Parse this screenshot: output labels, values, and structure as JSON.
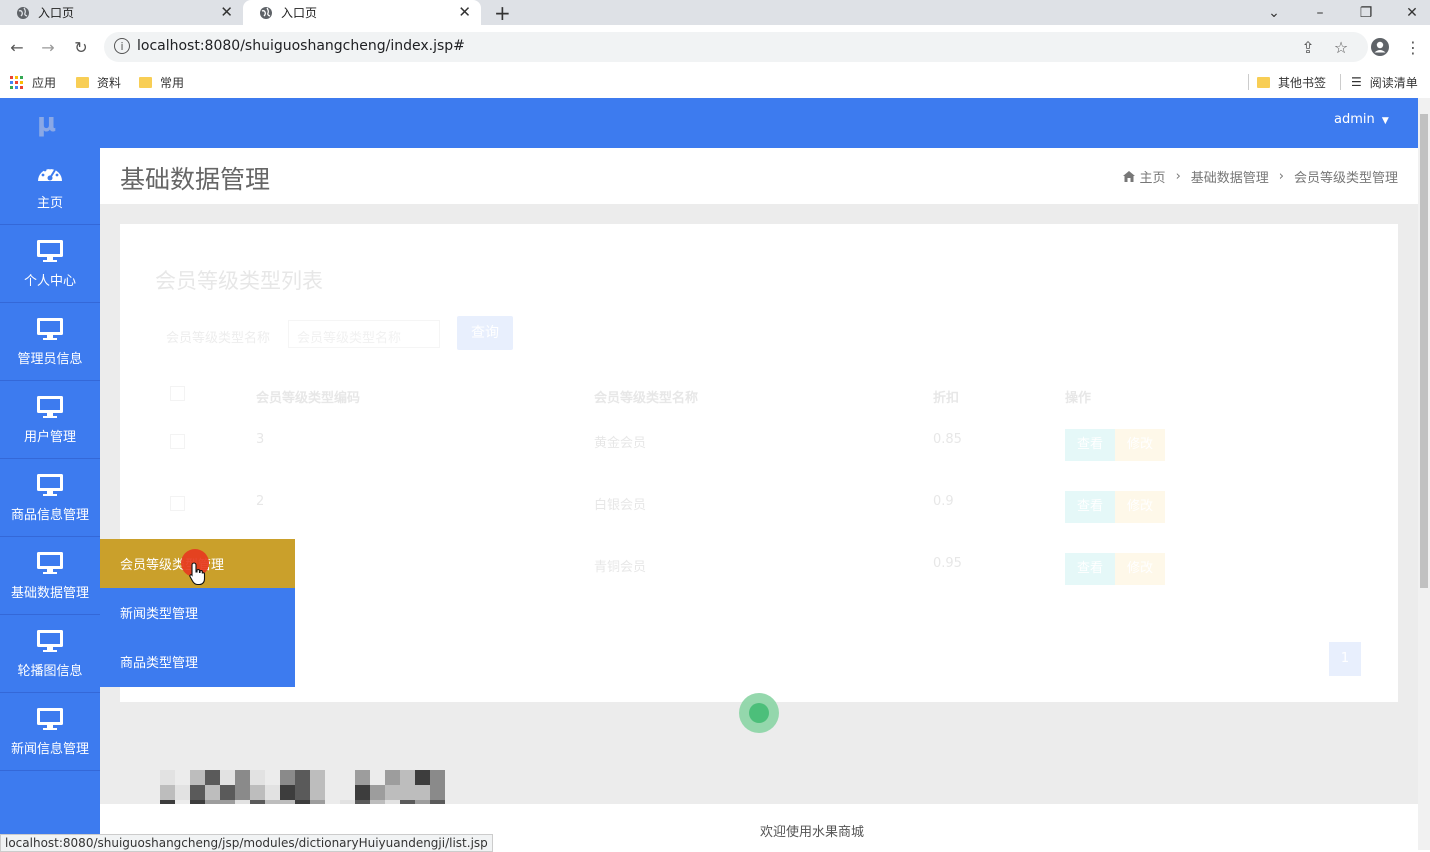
{
  "browser": {
    "tabs": [
      {
        "title": "入口页",
        "active": false
      },
      {
        "title": "入口页",
        "active": true
      }
    ],
    "url": "localhost:8080/shuiguoshangcheng/index.jsp#",
    "bookmarks": [
      "应用",
      "资料",
      "常用"
    ],
    "bookmarks_right": [
      "其他书签",
      "阅读清单"
    ],
    "status_url": "localhost:8080/shuiguoshangcheng/jsp/modules/dictionaryHuiyuandengji/list.jsp"
  },
  "app": {
    "logo": "μ",
    "user": "admin",
    "accent": "#3d7bef"
  },
  "sidebar": {
    "items": [
      {
        "label": "主页",
        "icon": "dashboard-icon"
      },
      {
        "label": "个人中心",
        "icon": "monitor-icon"
      },
      {
        "label": "管理员信息",
        "icon": "monitor-icon"
      },
      {
        "label": "用户管理",
        "icon": "monitor-icon"
      },
      {
        "label": "商品信息管理",
        "icon": "monitor-icon"
      },
      {
        "label": "基础数据管理",
        "icon": "monitor-icon"
      },
      {
        "label": "轮播图信息",
        "icon": "monitor-icon"
      },
      {
        "label": "新闻信息管理",
        "icon": "monitor-icon"
      }
    ]
  },
  "submenu": {
    "items": [
      "会员等级类型管理",
      "新闻类型管理",
      "商品类型管理"
    ],
    "active_index": 0
  },
  "header": {
    "title": "基础数据管理",
    "breadcrumb": [
      "主页",
      "基础数据管理",
      "会员等级类型管理"
    ]
  },
  "panel": {
    "title": "会员等级类型列表",
    "search_label": "会员等级类型名称",
    "search_placeholder": "会员等级类型名称",
    "search_button": "查询",
    "columns": [
      "会员等级类型编码",
      "会员等级类型名称",
      "折扣",
      "操作"
    ],
    "rows": [
      {
        "code": "3",
        "name": "黄金会员",
        "discount": "0.85"
      },
      {
        "code": "2",
        "name": "白银会员",
        "discount": "0.9"
      },
      {
        "code": "",
        "name": "青铜会员",
        "discount": "0.95"
      }
    ],
    "view_label": "查看",
    "edit_label": "修改",
    "page": "1"
  },
  "footer": {
    "text": "欢迎使用水果商城"
  }
}
